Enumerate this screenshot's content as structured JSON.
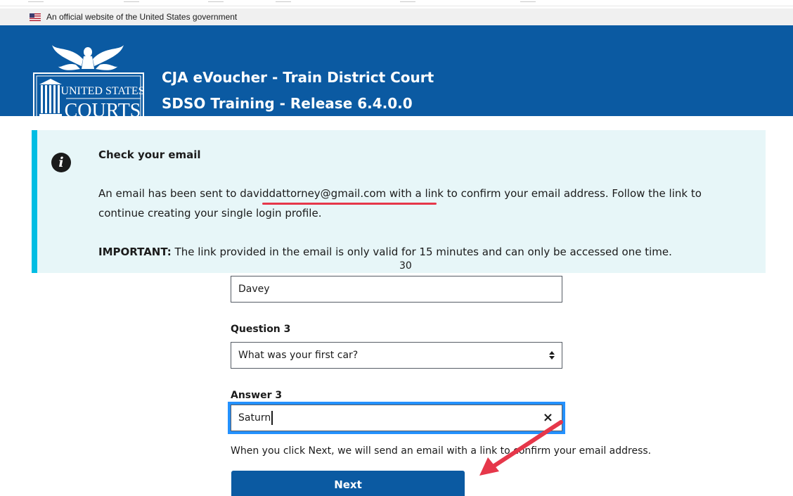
{
  "gov_banner": {
    "text": "An official website of the United States government"
  },
  "header": {
    "logo_text_top": "UNITED STATES",
    "logo_text_bottom": "COURTS",
    "title_line1": "CJA eVoucher - Train District Court",
    "title_line2": "SDSO Training - Release 6.4.0.0"
  },
  "alert": {
    "title": "Check your email",
    "body_line1": "An email has been sent to daviddattorney@gmail.com with a link to confirm your email address. Follow the link to",
    "body_line2": "continue creating your single login profile.",
    "important_label": "IMPORTANT:",
    "important_text": " The link provided in the email is only valid for 15 minutes and can only be accessed one time.",
    "info_icon": "info-icon",
    "colors": {
      "background": "#e7f6f8",
      "border": "#00bde3"
    }
  },
  "page_number": "30",
  "form": {
    "answer2_value": "Davey",
    "question3_label": "Question 3",
    "question3_value": "What was your first car?",
    "answer3_label": "Answer 3",
    "answer3_value": "Saturn",
    "clear_symbol": "×"
  },
  "helper_text": "When you click Next, we will send an email with a link to confirm your email address.",
  "next_button": "Next",
  "colors": {
    "header_blue": "#0b5aa2",
    "annotation_red": "#e6374a",
    "focus_blue": "#2491ff"
  }
}
